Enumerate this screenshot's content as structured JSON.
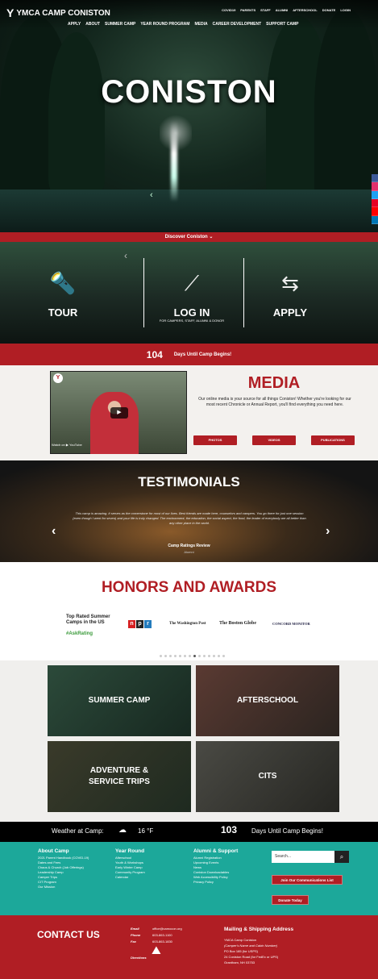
{
  "header": {
    "logo_text": "YMCA CAMP CONISTON",
    "logo_mark": "Y",
    "top_nav": [
      "COVID19",
      "PARENTS",
      "STAFF",
      "ALUMNI",
      "AFTERSCHOOL",
      "DONATE",
      "LOGIN"
    ],
    "main_nav": [
      "APPLY",
      "ABOUT",
      "SUMMER CAMP",
      "YEAR ROUND PROGRAM",
      "MEDIA",
      "CAREER DEVELOPMENT",
      "SUPPORT CAMP"
    ]
  },
  "hero": {
    "title": "CONISTON",
    "discover": "Discover Coniston ⌄"
  },
  "actions": [
    {
      "label": "TOUR",
      "sub": ""
    },
    {
      "label": "LOG IN",
      "sub": "FOR CAMPERS, STAFF, ALUMNI & DONOR"
    },
    {
      "label": "APPLY",
      "sub": ""
    }
  ],
  "countdown": {
    "number": "104",
    "text": "Days Until Camp Begins!"
  },
  "media": {
    "title": "MEDIA",
    "text": "Our online media is your source for all things Coniston! Whether you're looking for our most recent Chronicle or Annual Report, you'll find everything you need here.",
    "buttons": [
      "PHOTOS",
      "VIDEOS",
      "PUBLICATIONS"
    ],
    "video_bar": "Watch on  ▶ YouTube"
  },
  "testimonials": {
    "title": "TESTIMONIALS",
    "text": "This camp is amazing. It serves as the cornerstone for most of our lives. Best friends are made here, counselors and campers. You go there for just one session (even though I went for seven) and your life is truly changed. The environment, the education, the social aspect, the food, the leader of everybody are all better than any other place in the world.",
    "by": "Camp Ratings Review",
    "by2": "Alumni"
  },
  "honors": {
    "title": "HONORS AND AWARDS",
    "award1": "Top Rated Summer Camps in the US",
    "award1_tag": "#AskRating",
    "npr": [
      "n",
      "p",
      "r"
    ],
    "wapo": "The Washington Post",
    "globe": "The Boston Globe",
    "monitor": "CONCORD MONITOR"
  },
  "programs": [
    "SUMMER CAMP",
    "AFTERSCHOOL",
    "ADVENTURE & SERVICE TRIPS",
    "CITS"
  ],
  "weather": {
    "label": "Weather at Camp:",
    "icon": "☁",
    "temp": "16 °F",
    "count": "103",
    "count_text": "Days Until Camp Begins!"
  },
  "footer": {
    "about": {
      "h": "About Camp",
      "items": [
        "2021 Parent Handbook (COVID-19)",
        "Dates and Fees",
        "Chaos & Church (Job Offerings)",
        "Leadership Camp",
        "Camper Trips",
        "CIT Program",
        "Our Mission"
      ]
    },
    "year": {
      "h": "Year Round",
      "items": [
        "Afterschool",
        "Youth & Workshops",
        "Early Winter Camp",
        "Community Program",
        "Calendar"
      ]
    },
    "alumni": {
      "h": "Alumni & Support",
      "items": [
        "Alumni Registration",
        "Upcoming Events",
        "News",
        "Coniston Downloadables",
        "Web Accessibility Policy",
        "Privacy Policy"
      ]
    },
    "search_placeholder": "Search...",
    "join": "Join Our Communications List",
    "donate": "Donate Today"
  },
  "contact": {
    "title": "CONTACT US",
    "email_l": "Email",
    "email": "office@camocon.org",
    "phone_l": "Phone",
    "phone": "603-863-1100",
    "fax_l": "Fax",
    "fax": "603-863-1830",
    "dir_l": "Directions",
    "mail_h": "Mailing & Shipping Address",
    "mail": [
      "YMCA Camp Coniston",
      "(Camper's Name and Cabin Number)",
      "PO Box 185 (for USPS)",
      "24 Coniston Road (for FedEx or UPS)",
      "Grantham, NH 03753"
    ]
  }
}
